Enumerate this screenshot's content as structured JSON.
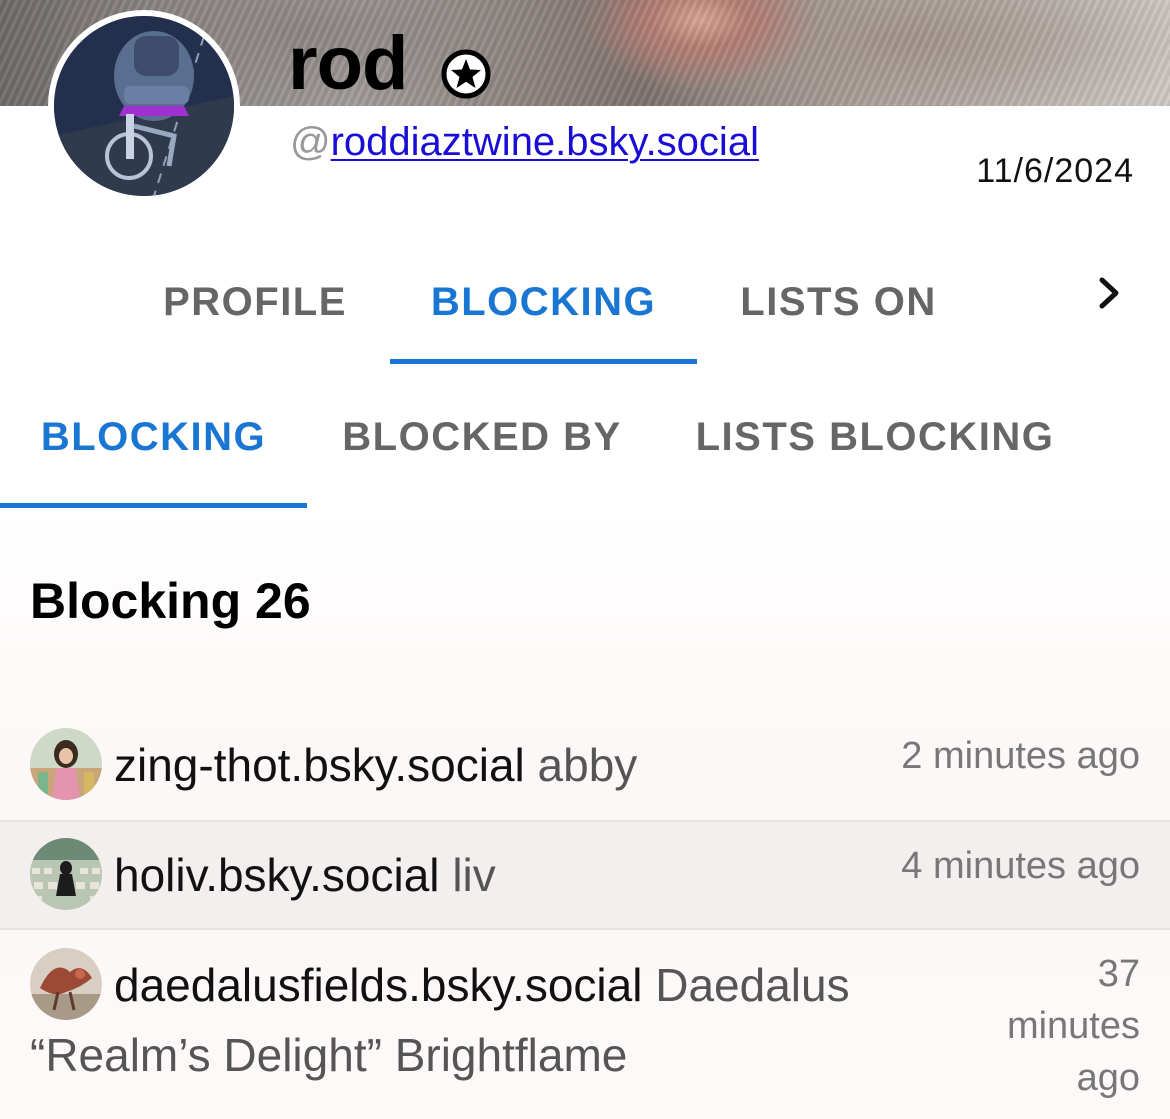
{
  "profile": {
    "display_name": "rod",
    "handle_prefix": "@",
    "handle": "roddiaztwine.bsky.social",
    "date": "11/6/2024",
    "badge_icon": "star-circle-icon",
    "avatar_icon": "profile-photo-bike"
  },
  "primary_tabs": [
    {
      "label": "PROFILE",
      "active": false
    },
    {
      "label": "BLOCKING",
      "active": true
    },
    {
      "label": "LISTS ON",
      "active": false
    }
  ],
  "more_tabs_icon": "chevron-right-icon",
  "secondary_tabs": [
    {
      "label": "BLOCKING",
      "active": true
    },
    {
      "label": "BLOCKED BY",
      "active": false
    },
    {
      "label": "LISTS BLOCKING",
      "active": false
    }
  ],
  "section": {
    "title": "Blocking 26"
  },
  "blocked_users": [
    {
      "handle": "zing-thot.bsky.social",
      "display_name": "abby",
      "time": "2 minutes ago"
    },
    {
      "handle": "holiv.bsky.social",
      "display_name": "liv",
      "time": "4 minutes ago"
    },
    {
      "handle": "daedalusfields.bsky.social",
      "display_name": "Daedalus “Realm’s Delight” Brightflame",
      "time_lines": [
        "37",
        "minutes",
        "ago"
      ]
    }
  ],
  "colors": {
    "accent": "#1976d2",
    "link": "#1a0dd6",
    "tab_inactive": "#666666"
  }
}
